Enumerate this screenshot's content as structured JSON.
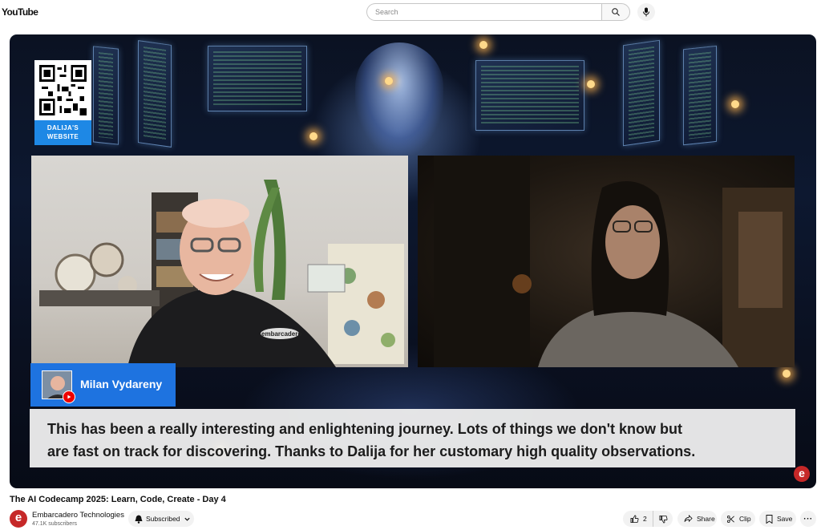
{
  "header": {
    "logo_text": "YouTube",
    "search_placeholder": "Search",
    "search_value": ""
  },
  "video": {
    "qr_label": "DALIJA'S WEBSITE",
    "speaker_name": "Milan Vydareny",
    "shirt_text": "embarcadero",
    "watermark": "e",
    "captions": [
      "This has been a really interesting and enlightening journey. Lots of things we don't know but",
      "are fast on track for discovering. Thanks to Dalija for her customary high quality observations."
    ]
  },
  "details": {
    "title": "The AI Codecamp 2025: Learn, Code, Create - Day 4",
    "channel_initial": "e",
    "channel_name": "Embarcadero Technologies",
    "subscribers": "47.1K subscribers",
    "subscribe_label": "Subscribed"
  },
  "actions": {
    "like_count": "2",
    "share_label": "Share",
    "clip_label": "Clip",
    "save_label": "Save",
    "more_label": "···"
  },
  "colors": {
    "accent_blue": "#1e73e0",
    "brand_red": "#c62828"
  },
  "icons": [
    "search-icon",
    "mic-icon",
    "bell-icon",
    "chevron-down-icon",
    "thumbs-up-icon",
    "thumbs-down-icon",
    "share-icon",
    "scissors-icon",
    "bookmark-icon",
    "more-icon"
  ]
}
